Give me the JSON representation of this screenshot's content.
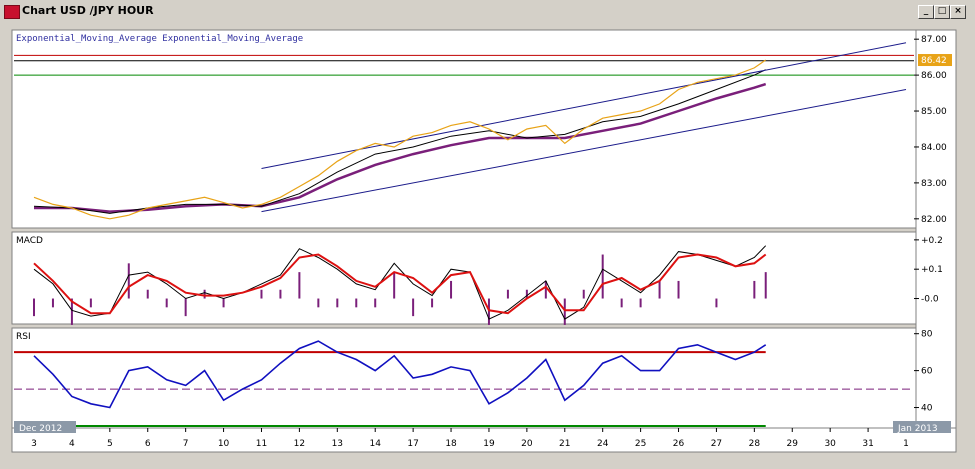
{
  "window": {
    "title": "Chart USD /JPY  HOUR",
    "minimize_icon": "minimize-icon",
    "maximize_icon": "maximize-icon",
    "close_icon": "close-icon"
  },
  "colors": {
    "price": "#e8a317",
    "ema_fast": "#000000",
    "ema_slow": "#7a1f7a",
    "channel": "#1a1a8a",
    "macd_line": "#000000",
    "macd_signal": "#dd1111",
    "macd_hist": "#7a1f7a",
    "rsi_line": "#1010c0",
    "rsi_overbought": "#ff33cc",
    "level_red": "#c00000",
    "level_green": "#008800",
    "last_price_bg": "#e8a317"
  },
  "chart_data": [
    {
      "type": "line",
      "panel": "price",
      "title": "Exponential_Moving_Average Exponential_Moving_Average",
      "ylim": [
        81.8,
        87.2
      ],
      "yticks": [
        "82.00",
        "83.00",
        "84.00",
        "85.00",
        "86.00",
        "87.00"
      ],
      "last_price": "86.42",
      "x_label_top": "Dec 2012",
      "x_label_end": "Jan 2013",
      "x_ticks": [
        "3",
        "4",
        "5",
        "6",
        "7",
        "10",
        "11",
        "12",
        "13",
        "14",
        "17",
        "18",
        "19",
        "20",
        "21",
        "24",
        "25",
        "26",
        "27",
        "28",
        "29",
        "30",
        "31",
        "1"
      ],
      "series": [
        {
          "role": "price",
          "x": [
            0,
            0.5,
            1,
            1.5,
            2,
            2.5,
            3,
            3.5,
            4,
            4.5,
            5,
            5.5,
            6,
            6.5,
            7,
            7.5,
            8,
            8.5,
            9,
            9.5,
            10,
            10.5,
            11,
            11.5,
            12,
            12.5,
            13,
            13.5,
            14,
            14.5,
            15,
            15.5,
            16,
            16.5,
            17,
            17.5,
            18,
            18.5,
            19,
            19.3
          ],
          "values": [
            82.6,
            82.4,
            82.3,
            82.1,
            82.0,
            82.1,
            82.3,
            82.4,
            82.5,
            82.6,
            82.45,
            82.3,
            82.4,
            82.6,
            82.9,
            83.2,
            83.6,
            83.9,
            84.1,
            84.0,
            84.3,
            84.4,
            84.6,
            84.7,
            84.5,
            84.2,
            84.5,
            84.6,
            84.1,
            84.5,
            84.8,
            84.9,
            85.0,
            85.2,
            85.6,
            85.8,
            85.9,
            86.0,
            86.2,
            86.42
          ]
        },
        {
          "role": "ema_fast",
          "x": [
            0,
            1,
            2,
            3,
            4,
            5,
            6,
            7,
            8,
            9,
            10,
            11,
            12,
            13,
            14,
            15,
            16,
            17,
            18,
            19,
            19.3
          ],
          "values": [
            82.35,
            82.3,
            82.15,
            82.3,
            82.4,
            82.4,
            82.35,
            82.7,
            83.3,
            83.8,
            84.0,
            84.3,
            84.45,
            84.25,
            84.35,
            84.7,
            84.85,
            85.2,
            85.6,
            86.0,
            86.15
          ]
        },
        {
          "role": "ema_slow",
          "x": [
            0,
            1,
            2,
            3,
            4,
            5,
            6,
            7,
            8,
            9,
            10,
            11,
            12,
            13,
            14,
            15,
            16,
            17,
            18,
            19,
            19.3
          ],
          "values": [
            82.3,
            82.3,
            82.2,
            82.25,
            82.35,
            82.4,
            82.35,
            82.6,
            83.1,
            83.5,
            83.8,
            84.05,
            84.25,
            84.25,
            84.25,
            84.45,
            84.65,
            85.0,
            85.35,
            85.65,
            85.75
          ]
        },
        {
          "role": "channel_upper",
          "x": [
            6,
            23
          ],
          "values": [
            83.4,
            86.9
          ]
        },
        {
          "role": "channel_lower",
          "x": [
            6,
            23
          ],
          "values": [
            82.2,
            85.6
          ]
        }
      ],
      "levels": [
        {
          "role": "red",
          "value": 86.55
        },
        {
          "role": "black",
          "value": 86.4
        },
        {
          "role": "green",
          "value": 86.0
        }
      ]
    },
    {
      "type": "line",
      "panel": "macd",
      "title": "MACD",
      "ylim": [
        -0.08,
        0.22
      ],
      "yticks": [
        "+0.2",
        "+0.1",
        "-0.0"
      ],
      "series": [
        {
          "role": "macd",
          "x": [
            0,
            0.5,
            1,
            1.5,
            2,
            2.5,
            3,
            3.5,
            4,
            4.5,
            5,
            5.5,
            6,
            6.5,
            7,
            7.5,
            8,
            8.5,
            9,
            9.5,
            10,
            10.5,
            11,
            11.5,
            12,
            12.5,
            13,
            13.5,
            14,
            14.5,
            15,
            15.5,
            16,
            16.5,
            17,
            17.5,
            18,
            18.5,
            19,
            19.3
          ],
          "values": [
            0.1,
            0.05,
            -0.04,
            -0.06,
            -0.05,
            0.08,
            0.09,
            0.05,
            -0.0,
            0.02,
            0.0,
            0.02,
            0.05,
            0.08,
            0.17,
            0.14,
            0.1,
            0.05,
            0.03,
            0.12,
            0.05,
            0.01,
            0.1,
            0.09,
            -0.07,
            -0.04,
            0.01,
            0.06,
            -0.07,
            -0.03,
            0.1,
            0.06,
            0.02,
            0.08,
            0.16,
            0.15,
            0.13,
            0.11,
            0.14,
            0.18
          ]
        },
        {
          "role": "signal",
          "x": [
            0,
            0.5,
            1,
            1.5,
            2,
            2.5,
            3,
            3.5,
            4,
            4.5,
            5,
            5.5,
            6,
            6.5,
            7,
            7.5,
            8,
            8.5,
            9,
            9.5,
            10,
            10.5,
            11,
            11.5,
            12,
            12.5,
            13,
            13.5,
            14,
            14.5,
            15,
            15.5,
            16,
            16.5,
            17,
            17.5,
            18,
            18.5,
            19,
            19.3
          ],
          "values": [
            0.12,
            0.06,
            -0.01,
            -0.05,
            -0.05,
            0.04,
            0.08,
            0.06,
            0.02,
            0.01,
            0.01,
            0.02,
            0.04,
            0.07,
            0.14,
            0.15,
            0.11,
            0.06,
            0.04,
            0.09,
            0.07,
            0.02,
            0.08,
            0.09,
            -0.04,
            -0.05,
            0.0,
            0.04,
            -0.04,
            -0.04,
            0.05,
            0.07,
            0.03,
            0.06,
            0.14,
            0.15,
            0.14,
            0.11,
            0.12,
            0.15
          ]
        }
      ]
    },
    {
      "type": "line",
      "panel": "rsi",
      "title": "RSI",
      "ylim": [
        30,
        82
      ],
      "yticks": [
        "80",
        "60",
        "40"
      ],
      "levels": [
        70,
        50,
        30
      ],
      "series": [
        {
          "role": "rsi",
          "x": [
            0,
            0.5,
            1,
            1.5,
            2,
            2.5,
            3,
            3.5,
            4,
            4.5,
            5,
            5.5,
            6,
            6.5,
            7,
            7.5,
            8,
            8.5,
            9,
            9.5,
            10,
            10.5,
            11,
            11.5,
            12,
            12.5,
            13,
            13.5,
            14,
            14.5,
            15,
            15.5,
            16,
            16.5,
            17,
            17.5,
            18,
            18.5,
            19,
            19.3
          ],
          "values": [
            68,
            58,
            46,
            42,
            40,
            60,
            62,
            55,
            52,
            60,
            44,
            50,
            55,
            64,
            72,
            76,
            70,
            66,
            60,
            68,
            56,
            58,
            62,
            60,
            42,
            48,
            56,
            66,
            44,
            52,
            64,
            68,
            60,
            60,
            72,
            74,
            70,
            66,
            70,
            74
          ]
        }
      ]
    }
  ]
}
